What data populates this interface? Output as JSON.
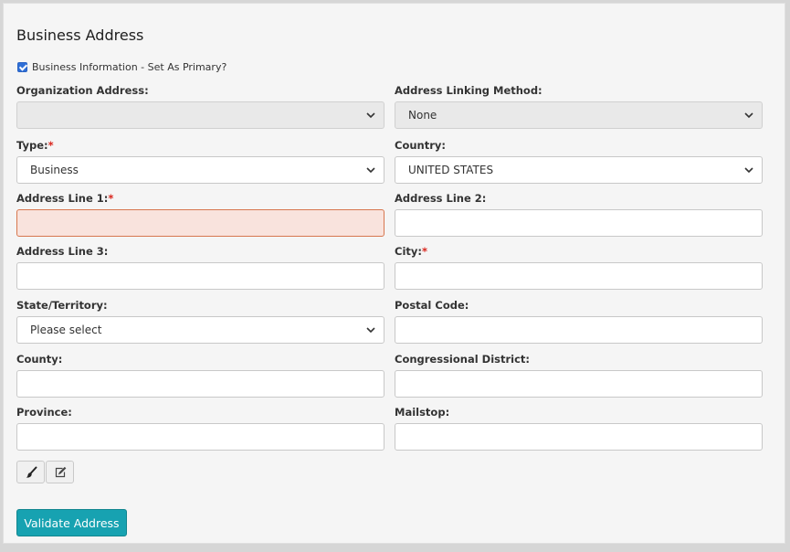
{
  "section": {
    "title": "Business Address",
    "primary_checkbox": {
      "label": "Business Information - Set As Primary?",
      "checked": true
    }
  },
  "fields": {
    "organization_address": {
      "label": "Organization Address:",
      "value": "",
      "required": false
    },
    "address_linking_method": {
      "label": "Address Linking Method:",
      "value": "None",
      "required": false
    },
    "type": {
      "label": "Type:",
      "value": "Business",
      "required": true
    },
    "country": {
      "label": "Country:",
      "value": "UNITED STATES",
      "required": false
    },
    "address_line_1": {
      "label": "Address Line 1:",
      "value": "",
      "required": true
    },
    "address_line_2": {
      "label": "Address Line 2:",
      "value": "",
      "required": false
    },
    "address_line_3": {
      "label": "Address Line 3:",
      "value": "",
      "required": false
    },
    "city": {
      "label": "City:",
      "value": "",
      "required": true
    },
    "state_territory": {
      "label": "State/Territory:",
      "value": "Please select",
      "required": false
    },
    "postal_code": {
      "label": "Postal Code:",
      "value": "",
      "required": false
    },
    "county": {
      "label": "County:",
      "value": "",
      "required": false
    },
    "congressional_district": {
      "label": "Congressional District:",
      "value": "",
      "required": false
    },
    "province": {
      "label": "Province:",
      "value": "",
      "required": false
    },
    "mailstop": {
      "label": "Mailstop:",
      "value": "",
      "required": false
    }
  },
  "toolbar": {
    "clear_icon": "paintbrush-icon",
    "edit_icon": "edit-icon"
  },
  "actions": {
    "validate_label": "Validate Address"
  },
  "colors": {
    "accent": "#17a2b1",
    "required_marker": "#d9251c",
    "error_background": "#f9e3dd",
    "error_border": "#d7774f",
    "checkbox": "#2f6fd6"
  }
}
